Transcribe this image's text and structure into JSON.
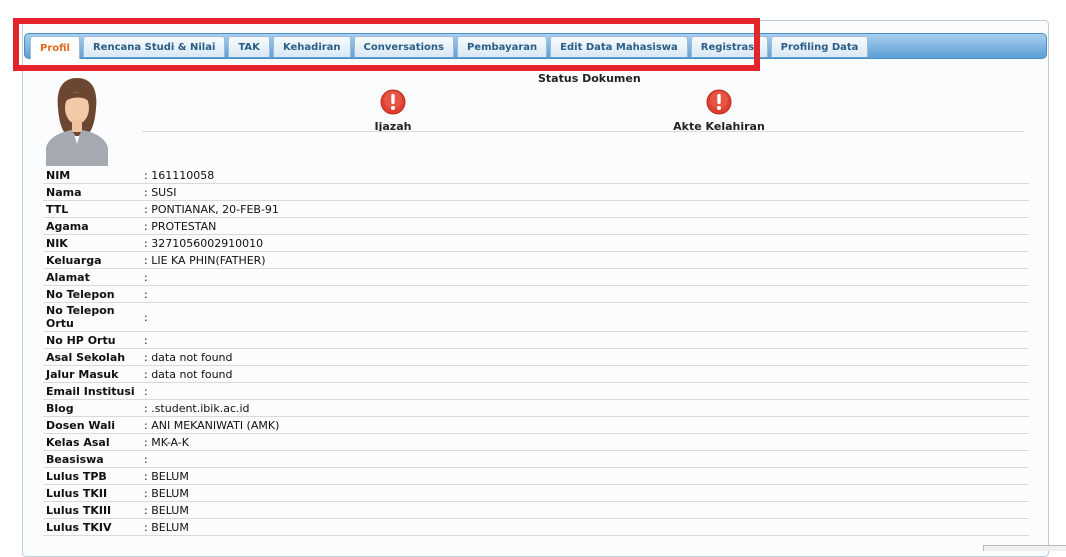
{
  "tabs": [
    {
      "label": "Profil",
      "active": true
    },
    {
      "label": "Rencana Studi & Nilai",
      "active": false
    },
    {
      "label": "TAK",
      "active": false
    },
    {
      "label": "Kehadiran",
      "active": false
    },
    {
      "label": "Conversations",
      "active": false
    },
    {
      "label": "Pembayaran",
      "active": false
    },
    {
      "label": "Edit Data Mahasiswa",
      "active": false
    },
    {
      "label": "Registrasi",
      "active": false
    },
    {
      "label": "Profiling Data",
      "active": false
    }
  ],
  "status": {
    "title": "Status Dokumen",
    "documents": [
      {
        "label": "Ijazah",
        "icon": "warning-icon"
      },
      {
        "label": "Akte Kelahiran",
        "icon": "warning-icon"
      }
    ]
  },
  "profile": {
    "rows": [
      {
        "label": "NIM",
        "value": ": 161110058"
      },
      {
        "label": "Nama",
        "value": ": SUSI"
      },
      {
        "label": "TTL",
        "value": ": PONTIANAK, 20-FEB-91"
      },
      {
        "label": "Agama",
        "value": ": PROTESTAN"
      },
      {
        "label": "NIK",
        "value": ": 3271056002910010"
      },
      {
        "label": "Keluarga",
        "value": ": LIE KA PHIN(FATHER)"
      },
      {
        "label": "Alamat",
        "value": ":"
      },
      {
        "label": "No Telepon",
        "value": ":"
      },
      {
        "label": "No Telepon Ortu",
        "value": ":"
      },
      {
        "label": "No HP Ortu",
        "value": ":"
      },
      {
        "label": "Asal Sekolah",
        "value": ": data not found"
      },
      {
        "label": "Jalur Masuk",
        "value": ": data not found"
      },
      {
        "label": "Email Institusi",
        "value": ":"
      },
      {
        "label": "Blog",
        "value": ": .student.ibik.ac.id"
      },
      {
        "label": "Dosen Wali",
        "value": ": ANI MEKANIWATI (AMK)"
      },
      {
        "label": "Kelas Asal",
        "value": ": MK-A-K"
      },
      {
        "label": "Beasiswa",
        "value": ":"
      },
      {
        "label": "Lulus TPB",
        "value": ": BELUM"
      },
      {
        "label": "Lulus TKII",
        "value": ": BELUM"
      },
      {
        "label": "Lulus TKIII",
        "value": ": BELUM"
      },
      {
        "label": "Lulus TKIV",
        "value": ": BELUM"
      }
    ]
  },
  "colors": {
    "highlight": "#e3242b",
    "active_tab_text": "#e06a1c",
    "tab_text": "#2b5d86",
    "warning": "#e0402f"
  }
}
